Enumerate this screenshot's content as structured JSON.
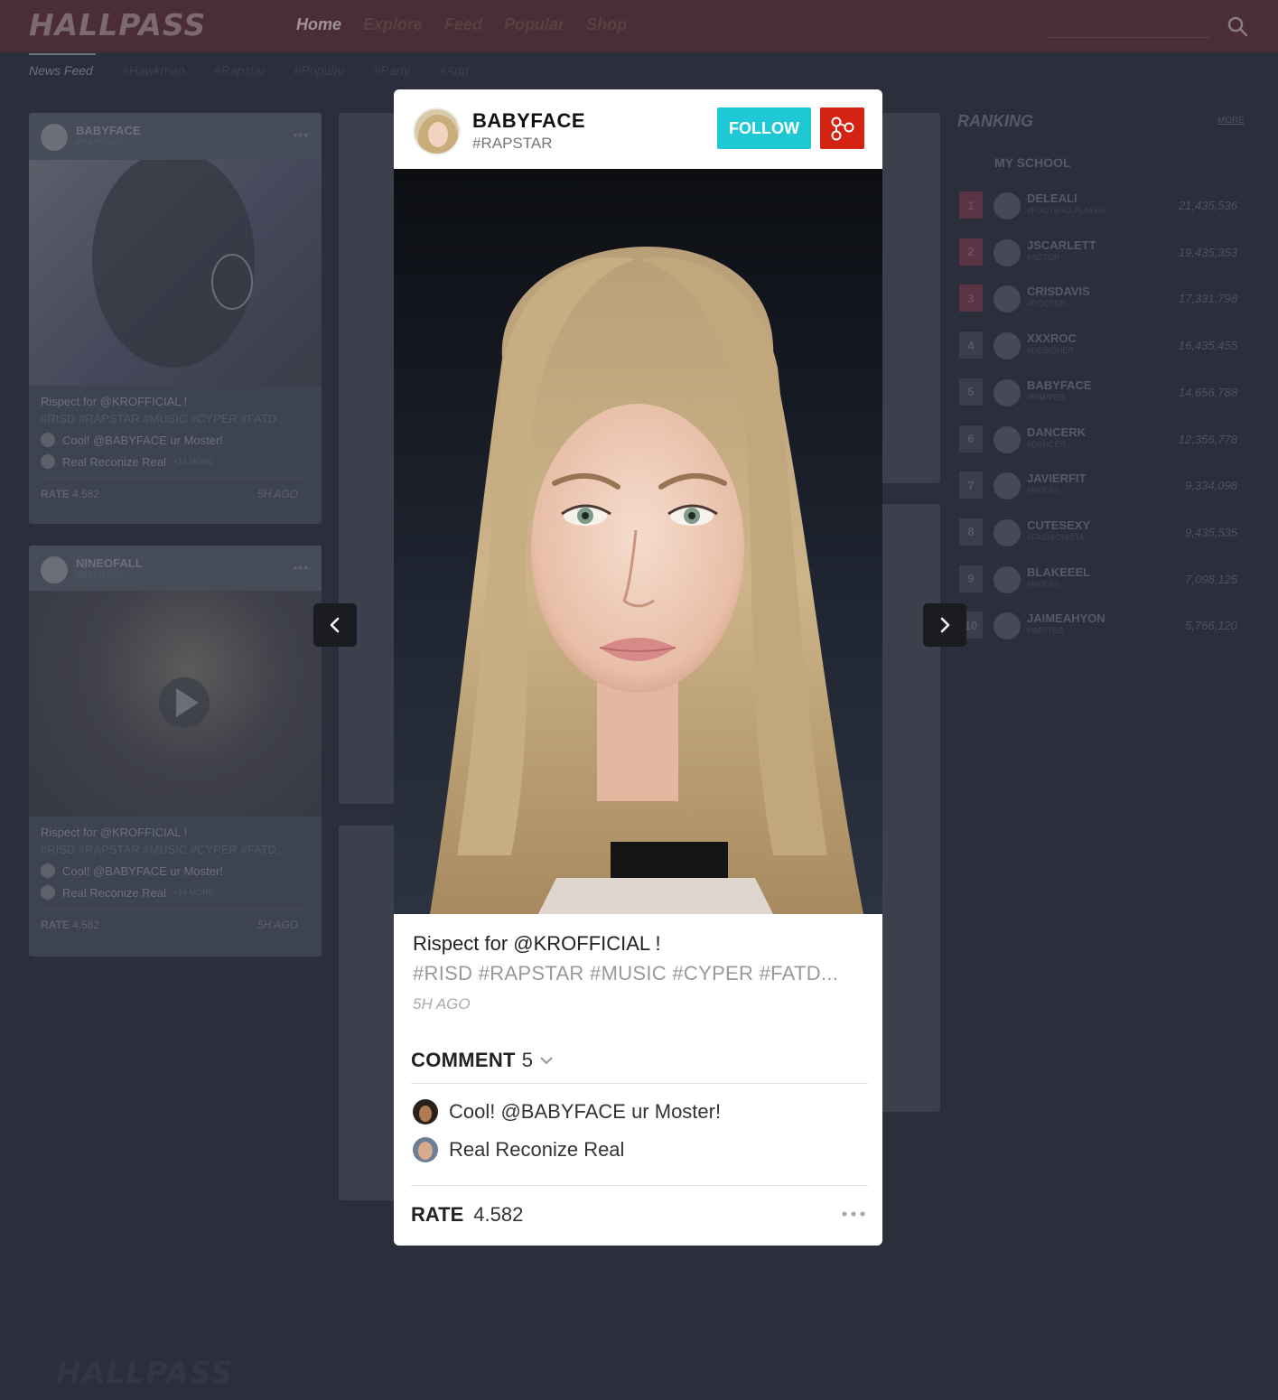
{
  "app": {
    "logo": "HALLPASS",
    "footer_logo": "HALLPASS"
  },
  "topnav": {
    "items": [
      "Home",
      "Explore",
      "Feed",
      "Popular",
      "Shop"
    ]
  },
  "subnav": {
    "items": [
      "News Feed",
      "#Hawkman",
      "#Rapstar",
      "#Popular",
      "#Party",
      "#Add"
    ]
  },
  "feed": {
    "cards": [
      {
        "name": "BABYFACE",
        "tag": "#RAPSTAR",
        "caption": "Rispect for @KROFFICIAL !",
        "tags": "#RISD #RAPSTAR #MUSIC #CYPER #FATD...",
        "comment1": "Cool! @BABYFACE ur Moster!",
        "comment2": "Real Reconize Real",
        "more": "+14 MORE",
        "rate_label": "RATE",
        "rate": "4.582",
        "time": "5H AGO"
      },
      {
        "name": "NINEOFALL",
        "tag": "#RAPSTAR",
        "caption": "Rispect for @KROFFICIAL !",
        "tags": "#RISD #RAPSTAR #MUSIC #CYPER #FATD...",
        "comment1": "Cool! @BABYFACE ur Moster!",
        "comment2": "Real Reconize Real",
        "more": "+14 MORE",
        "rate_label": "RATE",
        "rate": "4.582",
        "time": "5H AGO"
      }
    ]
  },
  "ranking": {
    "title": "RANKING",
    "more": "MORE",
    "school": "MY SCHOOL",
    "rows": [
      {
        "rank": "1",
        "name": "DELEALI",
        "sub": "#FOOTBALLPLAYER",
        "score": "21,435,536"
      },
      {
        "rank": "2",
        "name": "JSCARLETT",
        "sub": "#ACTOR",
        "score": "19,435,353"
      },
      {
        "rank": "3",
        "name": "CRISDAVIS",
        "sub": "#DOCTOR",
        "score": "17,331,798"
      },
      {
        "rank": "4",
        "name": "XXXROC",
        "sub": "#DESIGNER",
        "score": "16,435,455"
      },
      {
        "rank": "5",
        "name": "BABYFACE",
        "sub": "#RAPPER",
        "score": "14,656,788"
      },
      {
        "rank": "6",
        "name": "DANCERK",
        "sub": "#DANCER",
        "score": "12,356,778"
      },
      {
        "rank": "7",
        "name": "JAVIERFIT",
        "sub": "#MODEL",
        "score": "9,334,098"
      },
      {
        "rank": "8",
        "name": "CUTESEXY",
        "sub": "#FASHIONISTA",
        "score": "9,435,535"
      },
      {
        "rank": "9",
        "name": "BLAKEEEL",
        "sub": "#MODEL",
        "score": "7,098,125"
      },
      {
        "rank": "10",
        "name": "JAIMEAHYON",
        "sub": "#WRITER",
        "score": "5,766,120"
      }
    ]
  },
  "modal": {
    "name": "BABYFACE",
    "tag": "#RAPSTAR",
    "follow_label": "FOLLOW",
    "caption": "Rispect for @KROFFICIAL !",
    "hashtags": "#RISD #RAPSTAR #MUSIC #CYPER #FATD...",
    "time": "5H AGO",
    "comment_label": "COMMENT",
    "comment_count": "5",
    "comments": [
      {
        "text": "Cool! @BABYFACE ur Moster!"
      },
      {
        "text": "Real Reconize Real"
      }
    ],
    "rate_label": "RATE",
    "rate_value": "4.582"
  },
  "colors": {
    "accent_follow": "#1ec8d4",
    "share_red": "#d42312",
    "rank_hot": "#5a3344"
  },
  "icons": [
    "search-icon",
    "share-icon",
    "chevron-left-icon",
    "chevron-right-icon",
    "chevron-down-icon",
    "more-dots-icon",
    "play-icon"
  ]
}
